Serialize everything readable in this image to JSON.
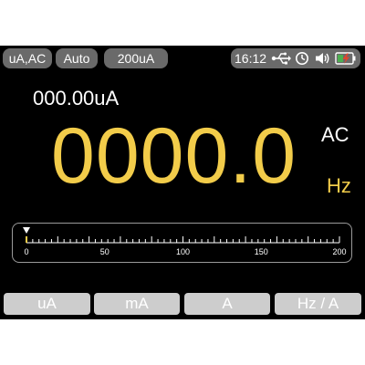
{
  "top_bar": {
    "function_label": "uA,AC",
    "range_mode_label": "Auto",
    "range_label": "200uA",
    "status": {
      "time": "16:12",
      "usb_icon": "usb-icon",
      "timer_icon": "clock-icon",
      "sound_icon": "speaker-icon",
      "battery_icon": "battery-charging-icon"
    }
  },
  "reading": {
    "secondary_value": "000.00uA",
    "main_value": "0000.0",
    "mode": "AC",
    "unit": "Hz"
  },
  "bar_graph": {
    "tick_labels": [
      "0",
      "50",
      "100",
      "150",
      "200"
    ],
    "scale_min": 0,
    "scale_max": 200,
    "pointer_value": 0,
    "colors": {
      "ticks": "#ffffff",
      "zero_marker": "#f2cc4a"
    }
  },
  "function_keys": [
    "uA",
    "mA",
    "A",
    "Hz / A"
  ],
  "colors": {
    "accent_yellow": "#f2cc4a",
    "pill_gray": "#6a6a6a",
    "key_gray": "#cdcdcd",
    "battery_green": "#4caf50",
    "battery_red": "#e0452e"
  }
}
